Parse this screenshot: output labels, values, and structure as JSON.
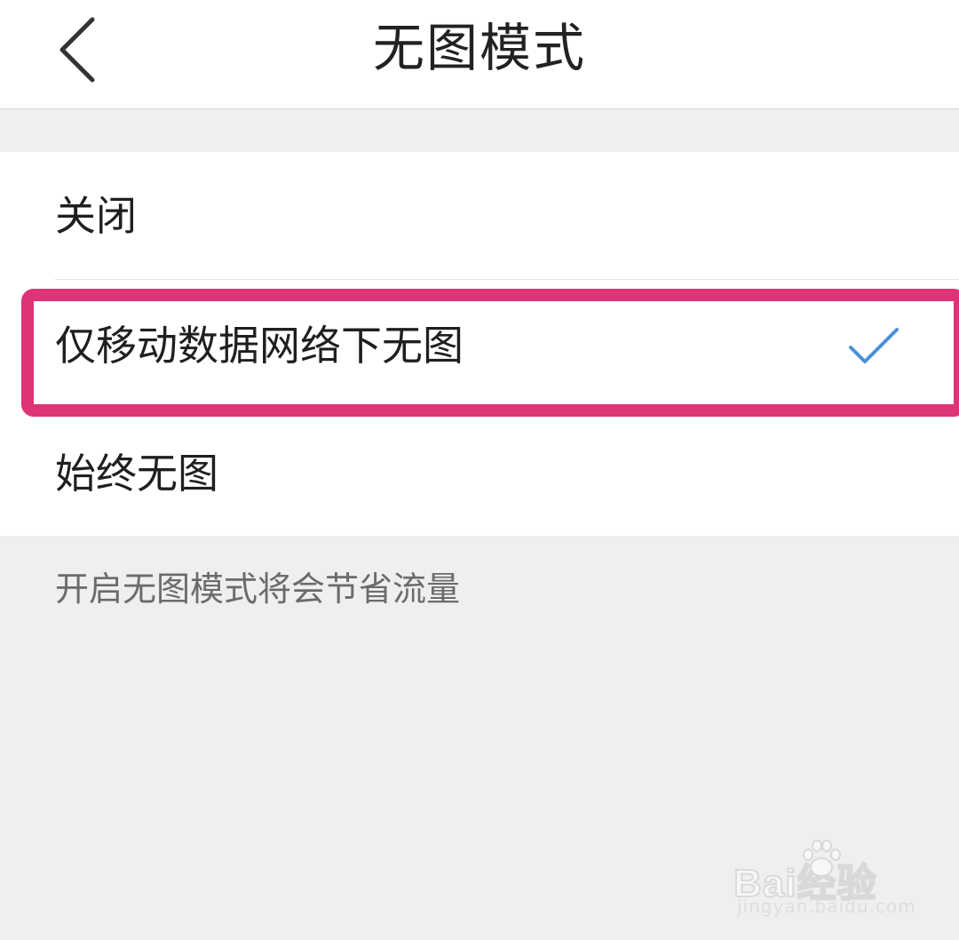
{
  "header": {
    "title": "无图模式",
    "back_icon": "chevron-left-icon"
  },
  "options": [
    {
      "label": "关闭",
      "selected": false
    },
    {
      "label": "仅移动数据网络下无图",
      "selected": true
    },
    {
      "label": "始终无图",
      "selected": false
    }
  ],
  "check_icon": "checkmark-icon",
  "colors": {
    "accent": "#4a90d9",
    "highlight": "#dd3377",
    "background": "#efefef"
  },
  "hint": "开启无图模式将会节省流量",
  "watermark": {
    "logo": "Bai经验",
    "url": "jingyan.baidu.com"
  }
}
